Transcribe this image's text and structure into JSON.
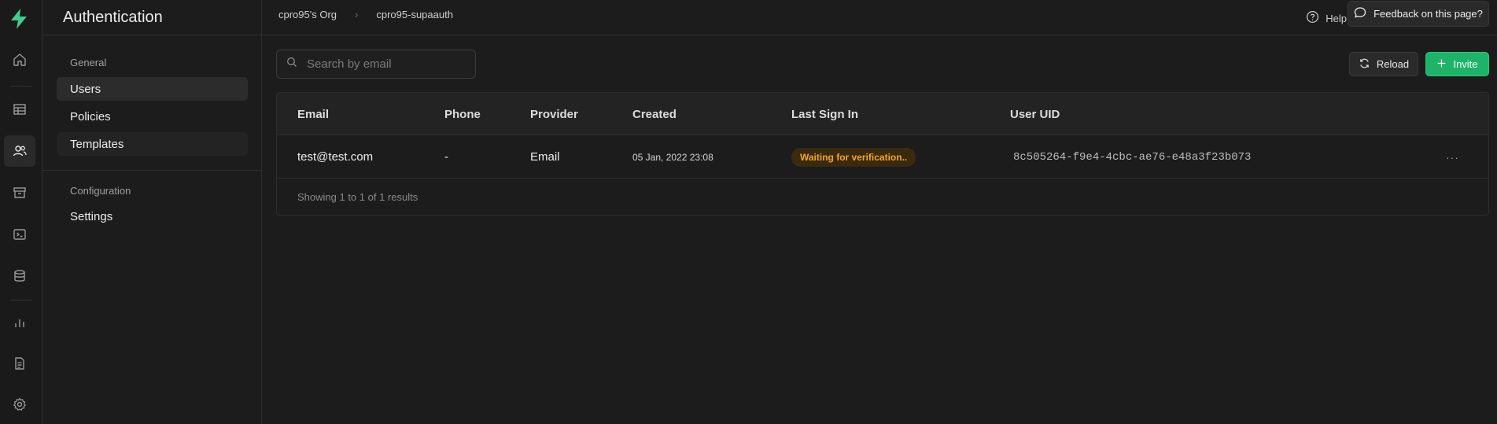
{
  "rail": {
    "items": [
      {
        "name": "home-icon"
      },
      {
        "name": "table-editor-icon"
      },
      {
        "name": "authentication-icon"
      },
      {
        "name": "storage-icon"
      },
      {
        "name": "sql-editor-icon"
      },
      {
        "name": "database-icon"
      },
      {
        "name": "reports-icon"
      },
      {
        "name": "api-docs-icon"
      },
      {
        "name": "settings-gear-icon"
      }
    ],
    "active": "authentication-icon",
    "brand_color": "#3ecf8e"
  },
  "sidebar": {
    "title": "Authentication",
    "groups": [
      {
        "label": "General",
        "items": [
          {
            "label": "Users"
          },
          {
            "label": "Policies"
          },
          {
            "label": "Templates"
          }
        ]
      },
      {
        "label": "Configuration",
        "items": [
          {
            "label": "Settings"
          }
        ]
      }
    ]
  },
  "topbar": {
    "breadcrumb": [
      "cpro95's Org",
      "cpro95-supaauth"
    ],
    "breadcrumb_sep": "›",
    "help_label": "Help",
    "feedback_label": "Feedback on this page?"
  },
  "toolbar": {
    "search_placeholder": "Search by email",
    "search_value": "",
    "reload_label": "Reload",
    "invite_label": "Invite",
    "accent_color": "#1db469"
  },
  "table": {
    "columns": [
      "Email",
      "Phone",
      "Provider",
      "Created",
      "Last Sign In",
      "User UID"
    ],
    "rows": [
      {
        "email": "test@test.com",
        "phone": "-",
        "provider": "Email",
        "created": "05 Jan, 2022 23:08",
        "last_sign_in": "Waiting for verification..",
        "uid": "8c505264-f9e4-4cbc-ae76-e48a3f23b073",
        "actions": "···"
      }
    ],
    "footer": "Showing 1 to 1 of 1 results",
    "status_color": "#f5a524"
  }
}
